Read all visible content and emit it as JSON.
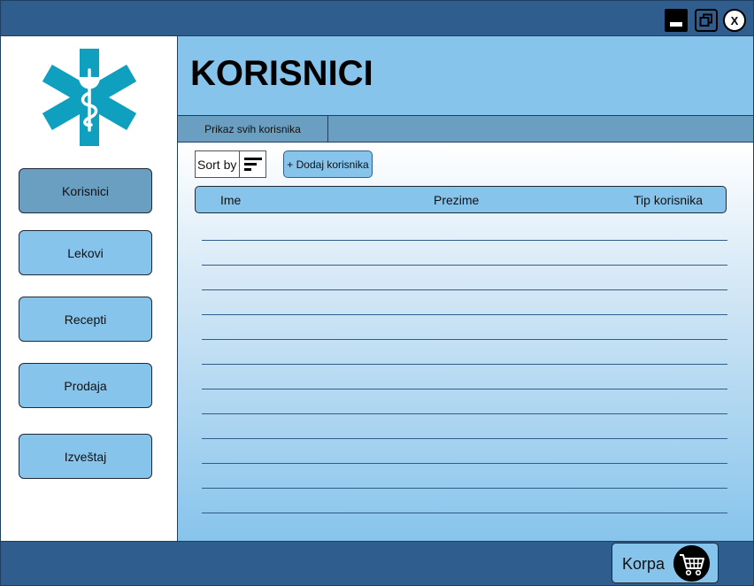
{
  "window": {
    "controls": {
      "minimize_icon": "minimize-icon",
      "restore_icon": "restore-icon",
      "close_label": "X"
    }
  },
  "sidebar": {
    "logo_icon": "star-of-life-icon",
    "items": [
      {
        "label": "Korisnici",
        "active": true
      },
      {
        "label": "Lekovi",
        "active": false
      },
      {
        "label": "Recepti",
        "active": false
      },
      {
        "label": "Prodaja",
        "active": false
      },
      {
        "label": "Izveštaj",
        "active": false
      }
    ]
  },
  "header": {
    "title": "KORISNICI"
  },
  "tabs": [
    {
      "label": "Prikaz svih korisnika"
    }
  ],
  "toolbar": {
    "sort_label": "Sort by",
    "sort_icon": "sort-icon",
    "add_label": "+ Dodaj korisnika"
  },
  "table": {
    "columns": [
      "Ime",
      "Prezime",
      "Tip korisnika"
    ],
    "rows": []
  },
  "footer": {
    "cart_label": "Korpa",
    "cart_icon": "shopping-cart-icon"
  },
  "colors": {
    "titlebar": "#2f5e8e",
    "accent": "#87c4ec",
    "active": "#6a9fc2",
    "logo": "#0fa0c0"
  }
}
